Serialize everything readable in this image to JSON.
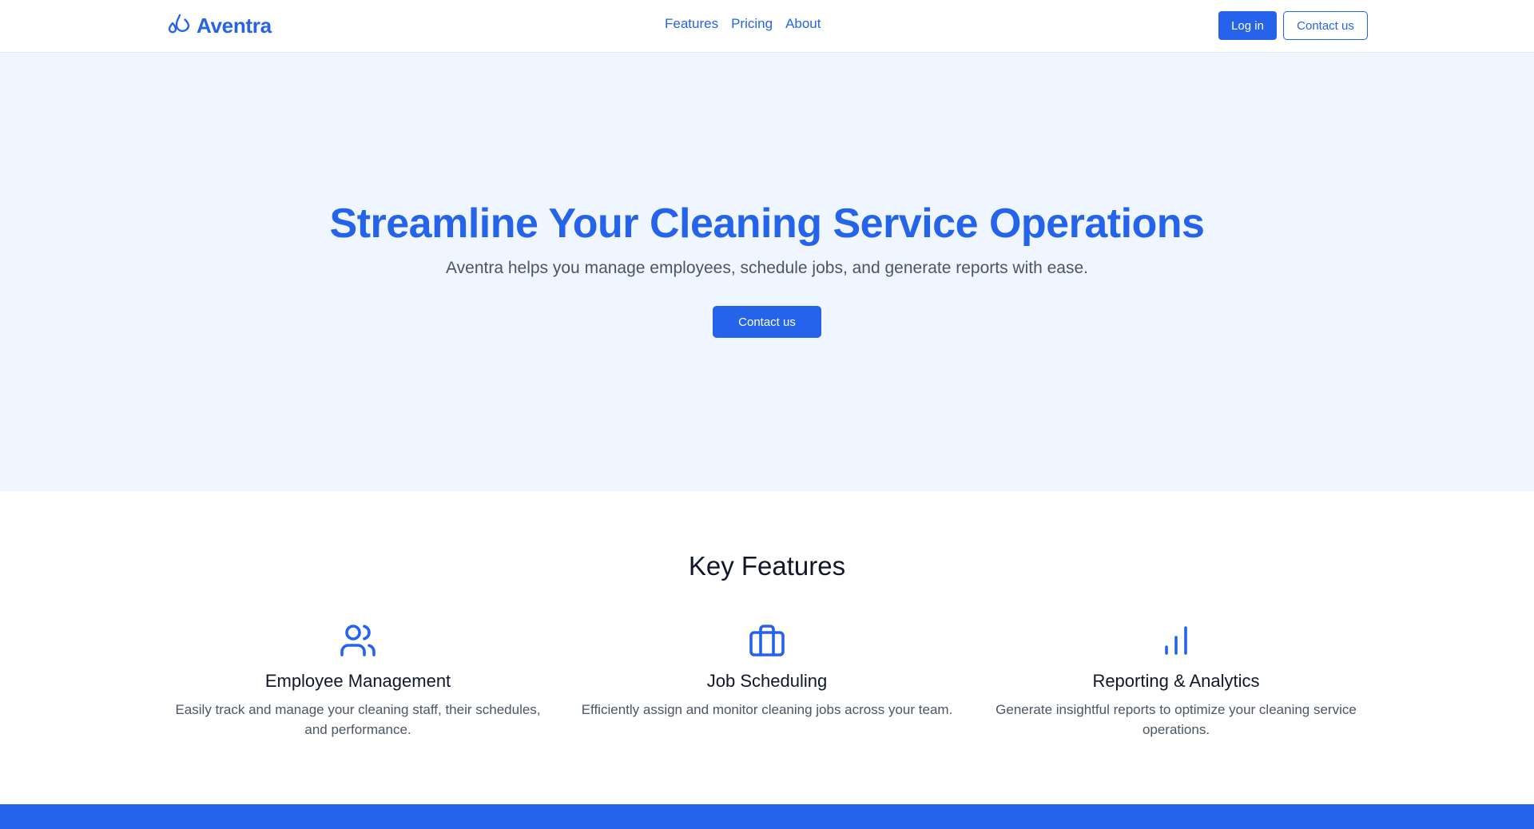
{
  "header": {
    "brand_name": "Aventra",
    "brand_icon": "droplets-icon",
    "nav": [
      {
        "label": "Features"
      },
      {
        "label": "Pricing"
      },
      {
        "label": "About"
      }
    ],
    "login_label": "Log in",
    "contact_label": "Contact us"
  },
  "hero": {
    "title": "Streamline Your Cleaning Service Operations",
    "subtitle": "Aventra helps you manage employees, schedule jobs, and generate reports with ease.",
    "cta_label": "Contact us"
  },
  "features": {
    "heading": "Key Features",
    "items": [
      {
        "icon": "users-icon",
        "title": "Employee Management",
        "description": "Easily track and manage your cleaning staff, their schedules, and performance."
      },
      {
        "icon": "briefcase-icon",
        "title": "Job Scheduling",
        "description": "Efficiently assign and monitor cleaning jobs across your team."
      },
      {
        "icon": "bar-chart-icon",
        "title": "Reporting & Analytics",
        "description": "Generate insightful reports to optimize your cleaning service operations."
      }
    ]
  },
  "colors": {
    "accent": "#2563eb",
    "hero_bg": "#eff6ff",
    "body_text": "#4b5563"
  }
}
